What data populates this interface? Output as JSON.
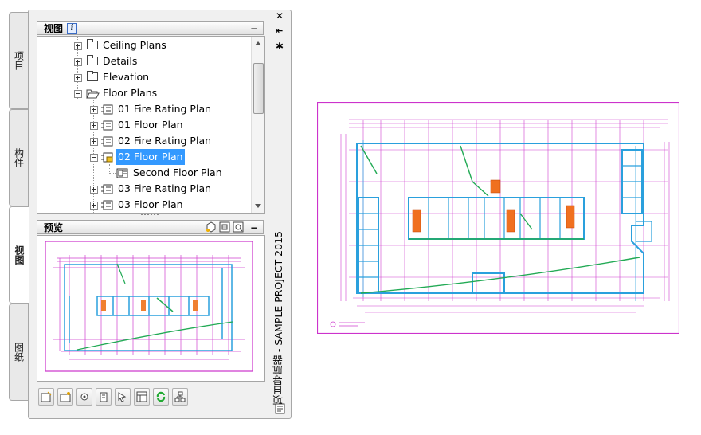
{
  "tabs": [
    {
      "label": "项目"
    },
    {
      "label": "构件"
    },
    {
      "label": "视图"
    },
    {
      "label": "图纸"
    }
  ],
  "views_panel": {
    "title": "视图",
    "info_icon": "info-icon",
    "collapse": "−",
    "tree": [
      {
        "label": "Ceiling Plans",
        "icon": "folder-icon"
      },
      {
        "label": "Details",
        "icon": "folder-icon"
      },
      {
        "label": "Elevation",
        "icon": "folder-icon"
      },
      {
        "label": "Floor Plans",
        "icon": "open-folder-icon"
      },
      {
        "label": "01 Fire Rating Plan",
        "icon": "view-icon"
      },
      {
        "label": "01 Floor Plan",
        "icon": "view-icon"
      },
      {
        "label": "02 Fire Rating Plan",
        "icon": "view-icon"
      },
      {
        "label": "02 Floor Plan",
        "icon": "locked-view-icon",
        "selected": true
      },
      {
        "label": "Second Floor Plan",
        "icon": "layout-icon"
      },
      {
        "label": "03 Fire Rating Plan",
        "icon": "view-icon"
      },
      {
        "label": "03 Floor Plan",
        "icon": "view-icon"
      }
    ]
  },
  "preview_panel": {
    "title": "预览",
    "collapse": "−"
  },
  "navigator_title": "项目导航器 - SAMPLE PROJECT 2015",
  "window_controls": {
    "close": "✕",
    "pin": "⇤",
    "settings": "✱"
  },
  "colors": {
    "accent": "#3399ff",
    "drawing_magenta": "#cc33cc",
    "drawing_cyan": "#33aadd",
    "drawing_green": "#22aa55"
  },
  "toolbar_icons": [
    "new-view-icon",
    "new-folder-icon",
    "settings-icon",
    "properties-icon",
    "select-icon",
    "layout-icon",
    "refresh-icon",
    "tree-icon"
  ]
}
